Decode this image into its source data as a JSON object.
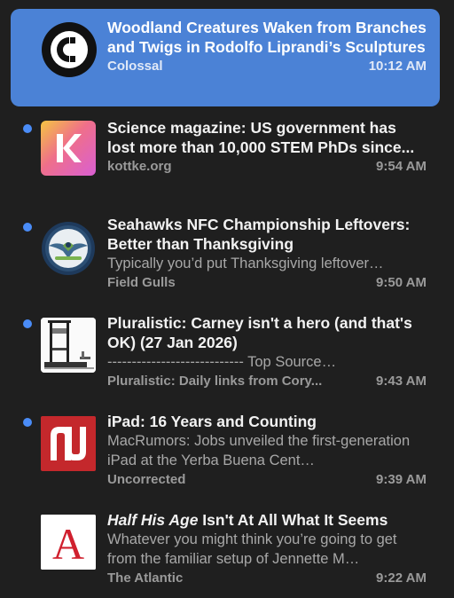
{
  "articles": [
    {
      "icon": "colossal-logo-icon",
      "title": "Woodland Creatures Waken from Branches and Twigs in Rodolfo Liprandi’s Sculptures",
      "summary": "",
      "source": "Colossal",
      "time": "10:12 AM",
      "unread": false,
      "selected": true
    },
    {
      "icon": "kottke-logo-icon",
      "title": "Science magazine: US government has lost more than 10,000 STEM PhDs since...",
      "summary": "",
      "source": "kottke.org",
      "time": "9:54 AM",
      "unread": true,
      "selected": false
    },
    {
      "icon": "field-gulls-logo-icon",
      "title": "Seahawks NFC Championship Leftovers: Better than Thanksgiving",
      "summary": "Typically you’d put Thanksgiving leftover…",
      "source": "Field Gulls",
      "time": "9:50 AM",
      "unread": true,
      "selected": false
    },
    {
      "icon": "pluralistic-logo-icon",
      "title": "Pluralistic: Carney isn't a hero (and that's OK) (27 Jan 2026)",
      "summary": "---------------------------- Top Source…",
      "source": "Pluralistic: Daily links from Cory...",
      "time": "9:43 AM",
      "unread": true,
      "selected": false
    },
    {
      "icon": "uncorrected-logo-icon",
      "title": "iPad: 16 Years and Counting",
      "summary": "MacRumors: Jobs unveiled the first-generation iPad at the Yerba Buena Cent…",
      "source": "Uncorrected",
      "time": "9:39 AM",
      "unread": true,
      "selected": false
    },
    {
      "icon": "atlantic-logo-icon",
      "title_italic": "Half His Age",
      "title": " Isn't At All What It Seems",
      "summary": "Whatever you might think you’re going to get from the familiar setup of Jennette M…",
      "source": "The Atlantic",
      "time": "9:22 AM",
      "unread": false,
      "selected": false
    }
  ],
  "colors": {
    "background": "#1f1f1f",
    "selected": "#4b82d6",
    "unread_dot": "#4a8cf7"
  }
}
